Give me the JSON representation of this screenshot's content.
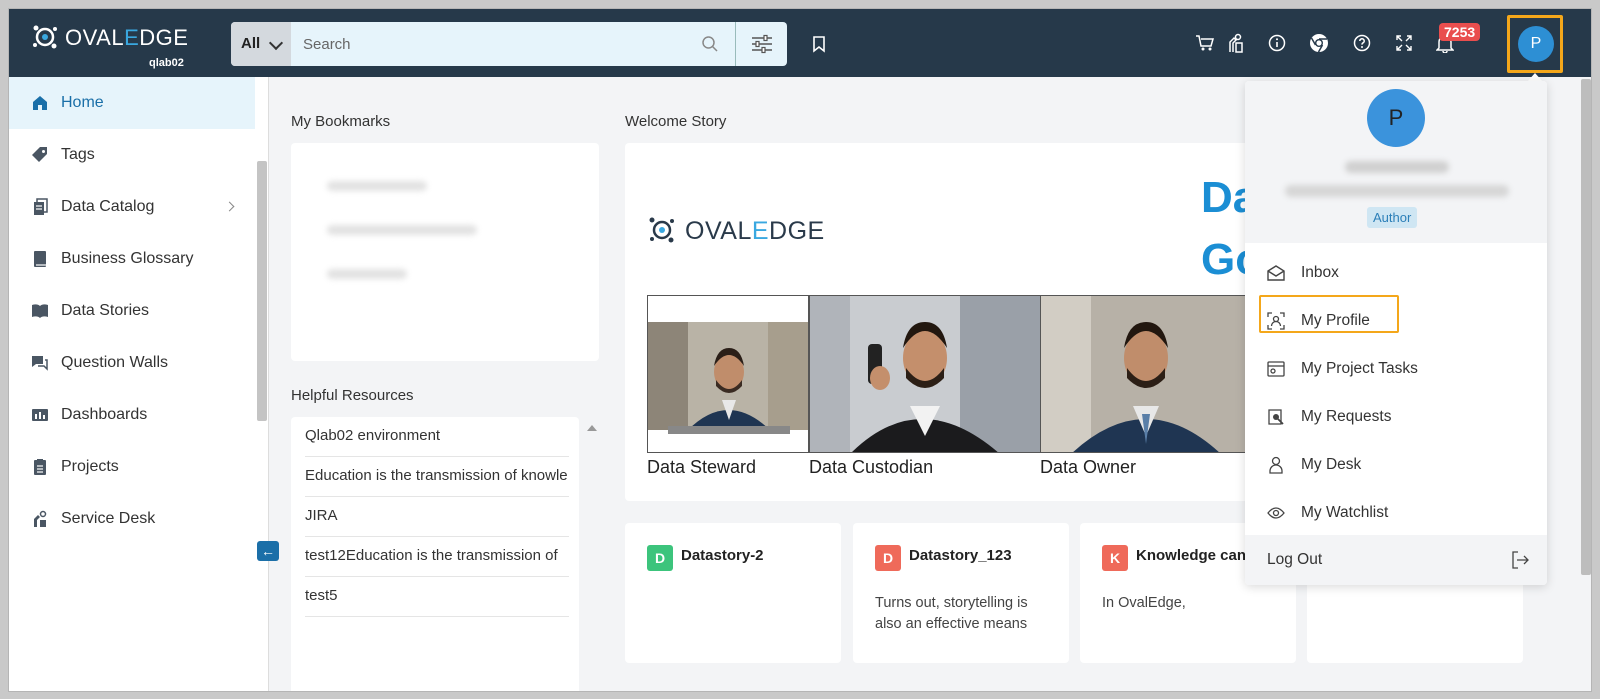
{
  "app": {
    "logo_text_pre": "OVAL",
    "logo_text_e": "E",
    "logo_text_post": "DGE",
    "env": "qlab02"
  },
  "search": {
    "scope": "All",
    "placeholder": "Search"
  },
  "header": {
    "notification_count": "7253",
    "avatar_initial": "P",
    "icons": [
      "cart-icon",
      "service-request-icon",
      "info-icon",
      "chrome-icon",
      "help-icon",
      "fullscreen-icon",
      "bell-icon"
    ]
  },
  "sidebar": {
    "items": [
      {
        "label": "Home",
        "icon": "home-icon"
      },
      {
        "label": "Tags",
        "icon": "tag-icon"
      },
      {
        "label": "Data Catalog",
        "icon": "catalog-icon"
      },
      {
        "label": "Business Glossary",
        "icon": "glossary-icon"
      },
      {
        "label": "Data Stories",
        "icon": "book-icon"
      },
      {
        "label": "Question Walls",
        "icon": "chat-icon"
      },
      {
        "label": "Dashboards",
        "icon": "dashboard-icon"
      },
      {
        "label": "Projects",
        "icon": "projects-icon"
      },
      {
        "label": "Service Desk",
        "icon": "service-desk-icon"
      }
    ]
  },
  "main": {
    "bookmarks_title": "My Bookmarks",
    "resources_title": "Helpful Resources",
    "resources": [
      "Qlab02 environment",
      "Education is the transmission of knowle",
      "JIRA",
      "test12Education is the transmission of",
      "test5"
    ],
    "welcome_title": "Welcome Story",
    "welcome_heading_1": "Da",
    "welcome_heading_2": "Go",
    "personas": [
      "Data Steward",
      "Data Custodian",
      "Data Owner"
    ],
    "stories": [
      {
        "badge": "D",
        "badge_color": "#3cc47c",
        "title": "Datastory-2",
        "desc": ""
      },
      {
        "badge": "D",
        "badge_color": "#ef6a5a",
        "title": "Datastory_123",
        "desc": "Turns out, storytelling is also an effective means"
      },
      {
        "badge": "K",
        "badge_color": "#ef6a5a",
        "title": "Knowledge can",
        "desc": "In OvalEdge,"
      }
    ]
  },
  "profile_menu": {
    "avatar_initial": "P",
    "role": "Author",
    "items": [
      "Inbox",
      "My Profile",
      "My Project Tasks",
      "My Requests",
      "My Desk",
      "My Watchlist"
    ],
    "logout": "Log Out"
  }
}
